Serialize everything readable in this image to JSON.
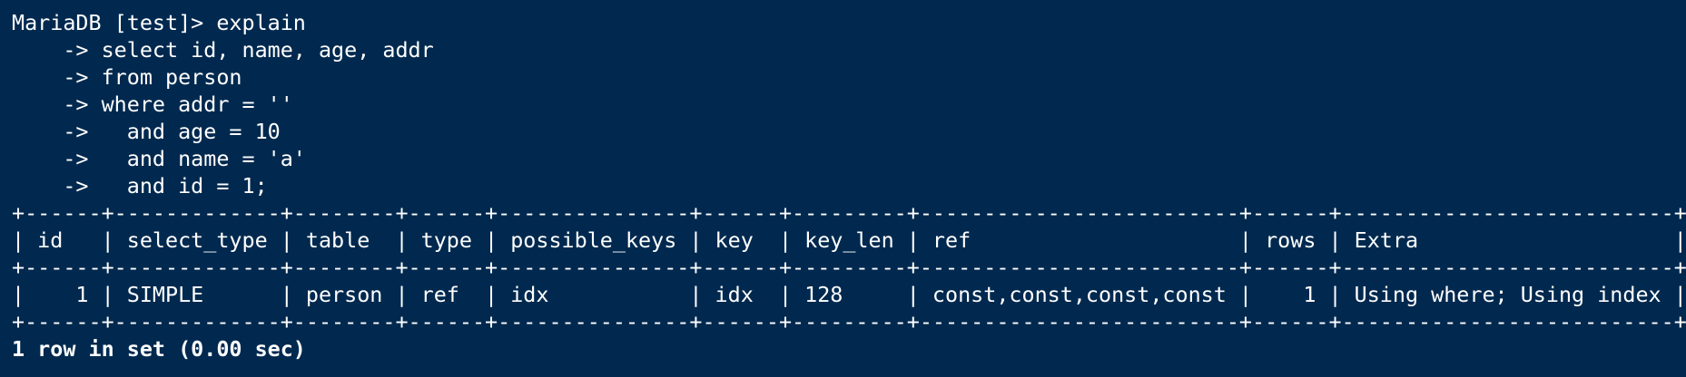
{
  "terminal": {
    "colors": {
      "background": "#01294f",
      "foreground": "#ffffff"
    },
    "query_lines": [
      "MariaDB [test]> explain",
      "    -> select id, name, age, addr",
      "    -> from person",
      "    -> where addr = ''",
      "    ->   and age = 10",
      "    ->   and name = 'a'",
      "    ->   and id = 1;"
    ],
    "table": {
      "border_top": "+------+-------------+--------+------+---------------+------+---------+-------------------------+------+--------------------------+",
      "header": "| id   | select_type | table  | type | possible_keys | key  | key_len | ref                     | rows | Extra                    |",
      "separator": "+------+-------------+--------+------+---------------+------+---------+-------------------------+------+--------------------------+",
      "rows": [
        "|    1 | SIMPLE      | person | ref  | idx           | idx  | 128     | const,const,const,const |    1 | Using where; Using index |"
      ],
      "border_bottom": "+------+-------------+--------+------+---------------+------+---------+-------------------------+------+--------------------------+"
    },
    "status_line": "1 row in set (0.00 sec)"
  }
}
